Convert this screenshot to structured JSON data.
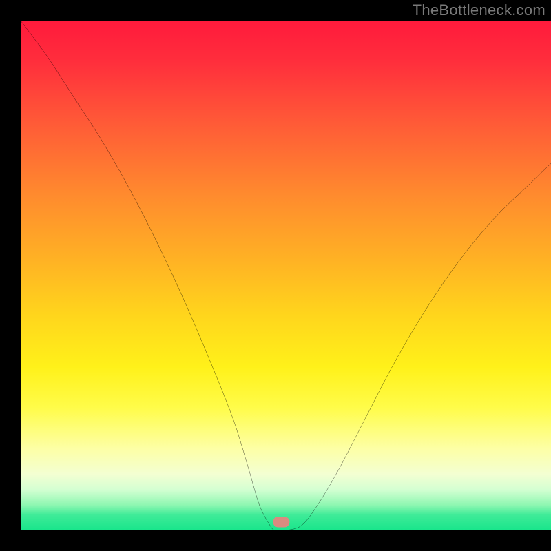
{
  "watermark": "TheBottleneck.com",
  "chart_data": {
    "type": "line",
    "title": "",
    "xlabel": "",
    "ylabel": "",
    "xlim": [
      0,
      100
    ],
    "ylim": [
      0,
      100
    ],
    "grid": false,
    "series": [
      {
        "name": "curve",
        "x": [
          0,
          5,
          10,
          15,
          20,
          25,
          30,
          35,
          40,
          43,
          45,
          47,
          48,
          50,
          53,
          56,
          60,
          65,
          70,
          75,
          80,
          85,
          90,
          95,
          100
        ],
        "y": [
          100,
          93,
          85,
          77,
          68,
          58,
          47,
          35,
          22,
          12,
          5,
          1,
          0,
          0,
          1,
          5,
          12,
          22,
          32,
          41,
          49,
          56,
          62,
          67,
          72
        ]
      }
    ],
    "annotations": {
      "marker": {
        "x": 49,
        "y": 0.8,
        "color": "#d98b80",
        "shape": "rounded-rect"
      }
    },
    "background_gradient": {
      "stops": [
        {
          "pct": 0,
          "color": "#ff1a3c"
        },
        {
          "pct": 50,
          "color": "#ffd61c"
        },
        {
          "pct": 75,
          "color": "#fffc4a"
        },
        {
          "pct": 100,
          "color": "#18e58b"
        }
      ]
    }
  }
}
